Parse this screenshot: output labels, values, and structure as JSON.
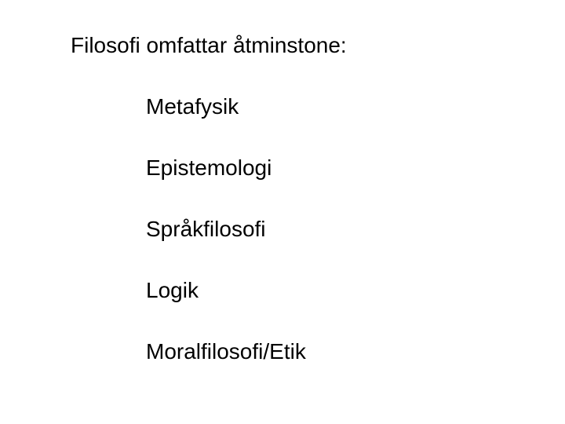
{
  "heading": "Filosofi omfattar åtminstone:",
  "items": [
    "Metafysik",
    "Epistemologi",
    "Språkfilosofi",
    "Logik",
    "Moralfilosofi/Etik"
  ]
}
